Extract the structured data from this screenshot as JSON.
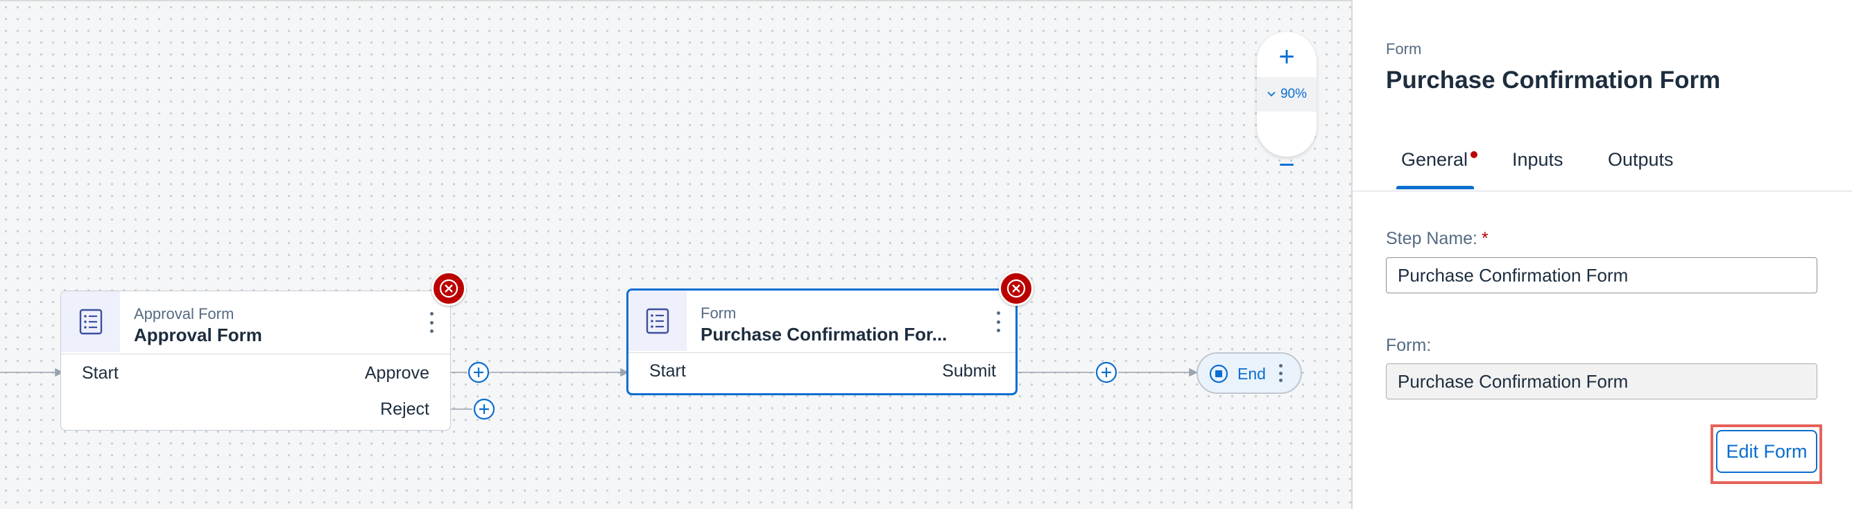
{
  "canvas": {
    "zoom": {
      "zoom_in_symbol": "+",
      "zoom_out_symbol": "−",
      "level": "90%"
    },
    "nodes": {
      "approval": {
        "type_label": "Approval Form",
        "title": "Approval Form",
        "input_port": "Start",
        "outputs": [
          "Approve",
          "Reject"
        ]
      },
      "purchase": {
        "type_label": "Form",
        "title": "Purchase Confirmation For...",
        "input_port": "Start",
        "outputs": [
          "Submit"
        ]
      },
      "end": {
        "label": "End"
      }
    }
  },
  "panel": {
    "subtitle": "Form",
    "title": "Purchase Confirmation Form",
    "tabs": [
      "General",
      "Inputs",
      "Outputs"
    ],
    "active_tab": "General",
    "fields": {
      "step_name": {
        "label": "Step Name:",
        "required_marker": "*",
        "value": "Purchase Confirmation Form"
      },
      "form": {
        "label": "Form:",
        "value": "Purchase Confirmation Form"
      }
    },
    "edit_button": "Edit Form"
  },
  "colors": {
    "accent": "#0a6ed1",
    "error": "#bb0000",
    "highlight": "#e5625a"
  }
}
